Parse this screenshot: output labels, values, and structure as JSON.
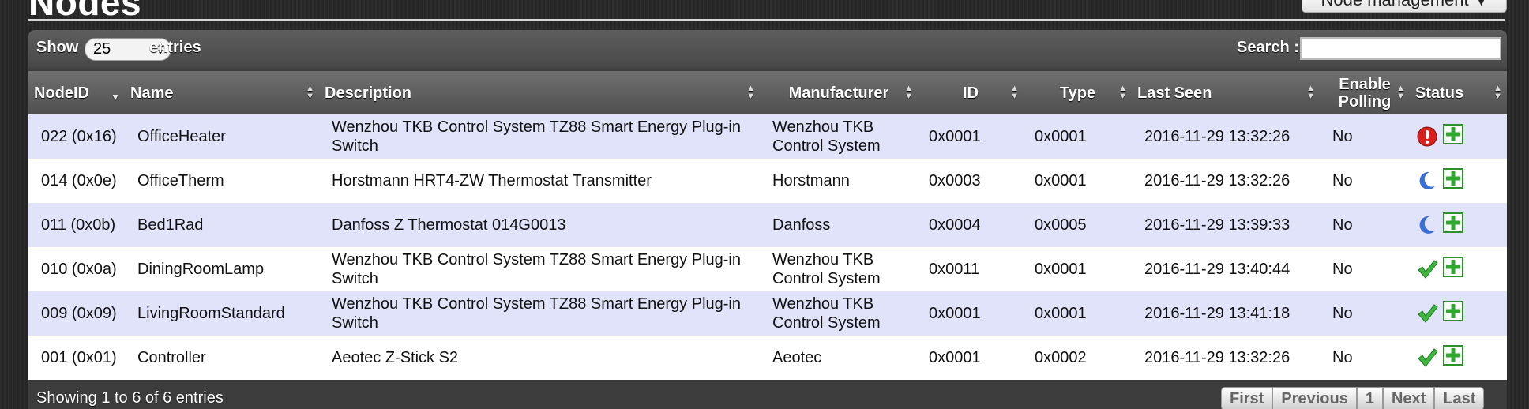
{
  "page": {
    "title": "Nodes",
    "node_management_button": "Node management"
  },
  "toolbar": {
    "show_label": "Show",
    "entries_value": "25",
    "entries_label": "entries",
    "search_label": "Search :"
  },
  "table": {
    "headers": [
      "NodeID",
      "Name",
      "Description",
      "Manufacturer",
      "ID",
      "Type",
      "Last Seen",
      "Enable Polling",
      "Status"
    ],
    "rows": [
      {
        "nodeid": "022 (0x16)",
        "name": "OfficeHeater",
        "description": "Wenzhou TKB Control System TZ88 Smart Energy Plug-in Switch",
        "manufacturer": "Wenzhou TKB Control System",
        "id": "0x0001",
        "type": "0x0001",
        "last_seen": "2016-11-29 13:32:26",
        "polling": "No",
        "status_icon": "error-icon"
      },
      {
        "nodeid": "014 (0x0e)",
        "name": "OfficeTherm",
        "description": "Horstmann HRT4-ZW Thermostat Transmitter",
        "manufacturer": "Horstmann",
        "id": "0x0003",
        "type": "0x0001",
        "last_seen": "2016-11-29 13:32:26",
        "polling": "No",
        "status_icon": "sleeping-moon-icon"
      },
      {
        "nodeid": "011 (0x0b)",
        "name": "Bed1Rad",
        "description": "Danfoss Z Thermostat 014G0013",
        "manufacturer": "Danfoss",
        "id": "0x0004",
        "type": "0x0005",
        "last_seen": "2016-11-29 13:39:33",
        "polling": "No",
        "status_icon": "sleeping-moon-icon"
      },
      {
        "nodeid": "010 (0x0a)",
        "name": "DiningRoomLamp",
        "description": "Wenzhou TKB Control System TZ88 Smart Energy Plug-in Switch",
        "manufacturer": "Wenzhou TKB Control System",
        "id": "0x0011",
        "type": "0x0001",
        "last_seen": "2016-11-29 13:40:44",
        "polling": "No",
        "status_icon": "checkmark-icon"
      },
      {
        "nodeid": "009 (0x09)",
        "name": "LivingRoomStandard",
        "description": "Wenzhou TKB Control System TZ88 Smart Energy Plug-in Switch",
        "manufacturer": "Wenzhou TKB Control System",
        "id": "0x0001",
        "type": "0x0001",
        "last_seen": "2016-11-29 13:41:18",
        "polling": "No",
        "status_icon": "checkmark-icon"
      },
      {
        "nodeid": "001 (0x01)",
        "name": "Controller",
        "description": "Aeotec Z-Stick S2",
        "manufacturer": "Aeotec",
        "id": "0x0001",
        "type": "0x0002",
        "last_seen": "2016-11-29 13:32:26",
        "polling": "No",
        "status_icon": "checkmark-icon"
      }
    ]
  },
  "footer": {
    "info": "Showing 1 to 6 of 6 entries"
  },
  "pagination": {
    "first": "First",
    "previous": "Previous",
    "page": "1",
    "next": "Next",
    "last": "Last"
  },
  "colors": {
    "row_odd": "#e1e3fb",
    "row_even": "#ffffff",
    "ok_green": "#3db83d",
    "error_red": "#d9201c",
    "moon_blue": "#3b6fd8"
  }
}
